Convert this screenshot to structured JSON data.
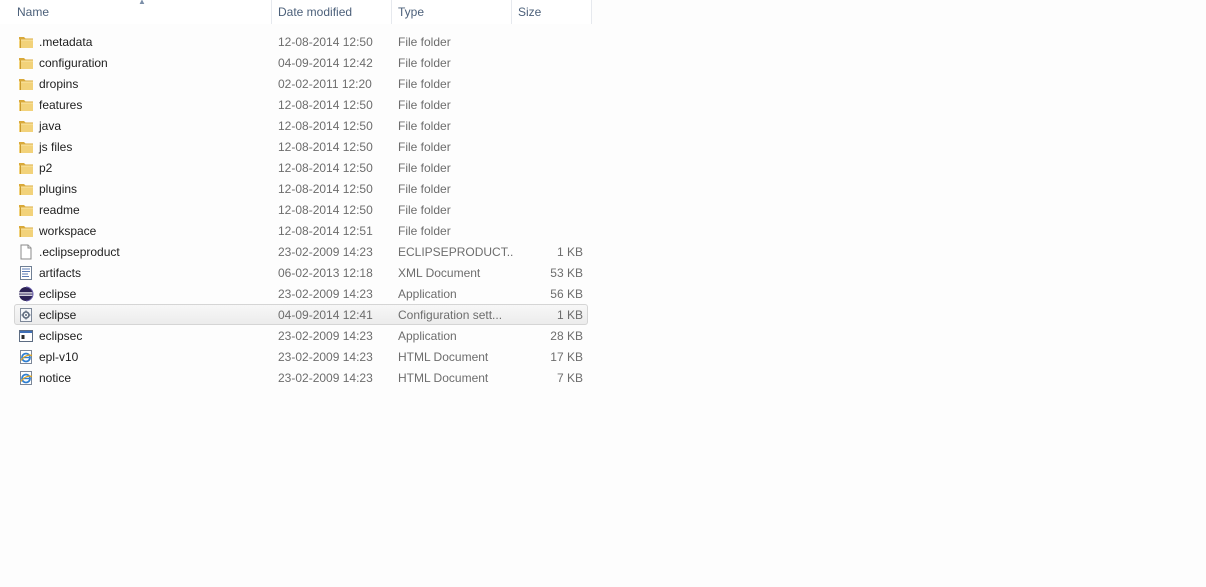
{
  "columns": {
    "name": "Name",
    "date": "Date modified",
    "type": "Type",
    "size": "Size"
  },
  "files": [
    {
      "name": ".metadata",
      "date": "12-08-2014 12:50",
      "type": "File folder",
      "size": "",
      "icon": "folder-icon"
    },
    {
      "name": "configuration",
      "date": "04-09-2014 12:42",
      "type": "File folder",
      "size": "",
      "icon": "folder-icon"
    },
    {
      "name": "dropins",
      "date": "02-02-2011 12:20",
      "type": "File folder",
      "size": "",
      "icon": "folder-icon"
    },
    {
      "name": "features",
      "date": "12-08-2014 12:50",
      "type": "File folder",
      "size": "",
      "icon": "folder-icon"
    },
    {
      "name": "java",
      "date": "12-08-2014 12:50",
      "type": "File folder",
      "size": "",
      "icon": "folder-icon"
    },
    {
      "name": "js files",
      "date": "12-08-2014 12:50",
      "type": "File folder",
      "size": "",
      "icon": "folder-icon"
    },
    {
      "name": "p2",
      "date": "12-08-2014 12:50",
      "type": "File folder",
      "size": "",
      "icon": "folder-icon"
    },
    {
      "name": "plugins",
      "date": "12-08-2014 12:50",
      "type": "File folder",
      "size": "",
      "icon": "folder-icon"
    },
    {
      "name": "readme",
      "date": "12-08-2014 12:50",
      "type": "File folder",
      "size": "",
      "icon": "folder-icon"
    },
    {
      "name": "workspace",
      "date": "12-08-2014 12:51",
      "type": "File folder",
      "size": "",
      "icon": "folder-icon"
    },
    {
      "name": ".eclipseproduct",
      "date": "23-02-2009 14:23",
      "type": "ECLIPSEPRODUCT...",
      "size": "1 KB",
      "icon": "blank-file-icon"
    },
    {
      "name": "artifacts",
      "date": "06-02-2013 12:18",
      "type": "XML Document",
      "size": "53 KB",
      "icon": "xml-document-icon"
    },
    {
      "name": "eclipse",
      "date": "23-02-2009 14:23",
      "type": "Application",
      "size": "56 KB",
      "icon": "eclipse-app-icon"
    },
    {
      "name": "eclipse",
      "date": "04-09-2014 12:41",
      "type": "Configuration sett...",
      "size": "1 KB",
      "icon": "config-settings-icon"
    },
    {
      "name": "eclipsec",
      "date": "23-02-2009 14:23",
      "type": "Application",
      "size": "28 KB",
      "icon": "application-window-icon"
    },
    {
      "name": "epl-v10",
      "date": "23-02-2009 14:23",
      "type": "HTML Document",
      "size": "17 KB",
      "icon": "html-document-icon"
    },
    {
      "name": "notice",
      "date": "23-02-2009 14:23",
      "type": "HTML Document",
      "size": "7 KB",
      "icon": "html-document-icon"
    }
  ],
  "hovered_row": 13,
  "colors": {
    "header_text": "#4c607a",
    "folder": "#e8c25a",
    "hover_border": "#d5d5d5"
  }
}
